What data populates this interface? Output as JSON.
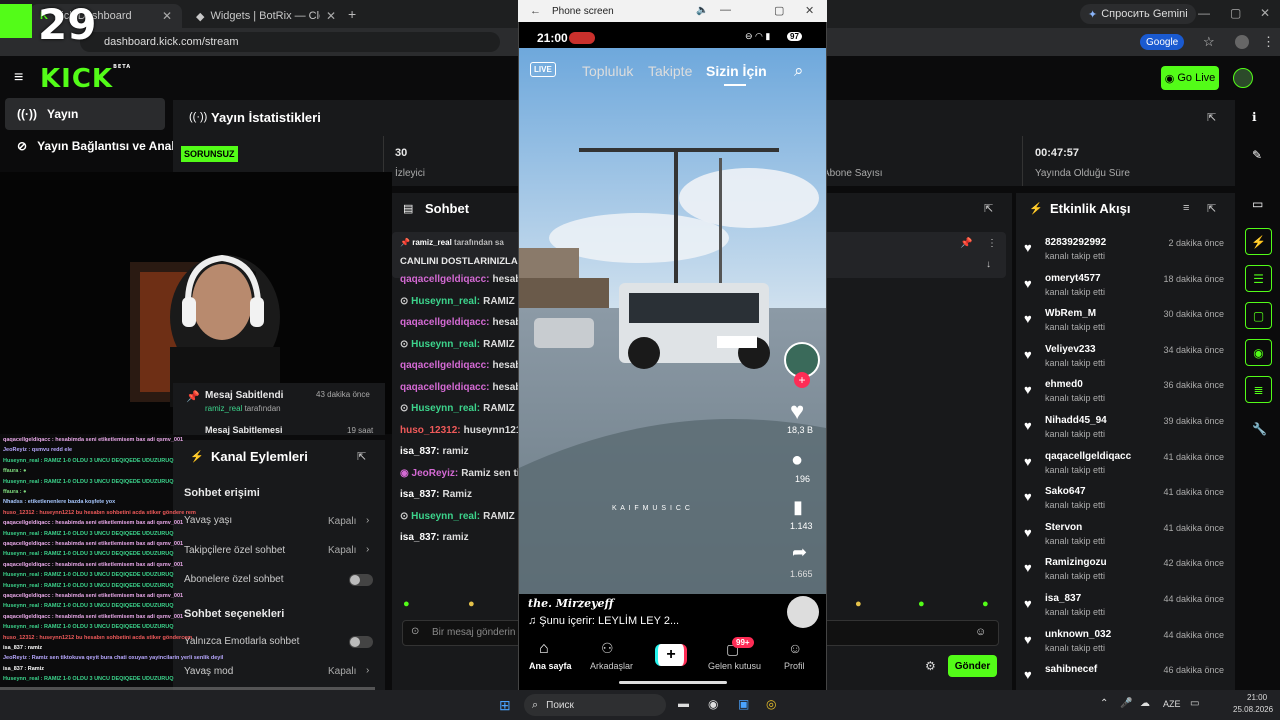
{
  "browser": {
    "tabs": [
      {
        "label": "Kick Dashboard"
      },
      {
        "label": "Widgets | BotRix — Cloud Strea"
      }
    ],
    "new_tab": "+",
    "url": "dashboard.kick.com/stream",
    "gemini": "Спросить Gemini",
    "google": "Google"
  },
  "overlay_counter": "29",
  "kick": {
    "logo": "KICK",
    "beta": "BETA",
    "go_live": "Go Live",
    "nav": [
      {
        "label": "Yayın"
      },
      {
        "label": "Yayın Bağlantısı ve Anahta"
      }
    ]
  },
  "stats": {
    "title": "Yayın İstatistikleri",
    "status_badge": "SORUNSUZ",
    "viewers_value": "30",
    "viewers_label": "İzleyici",
    "subs_label": "Abone Sayısı",
    "duration_value": "00:47:57",
    "duration_label": "Yayında Olduğu Süre"
  },
  "pinned": {
    "title": "Mesaj Sabitlendi",
    "by": "ramiz_real",
    "by_suffix": "tarafından",
    "time": "43 dakika önce",
    "title2": "Mesaj Sabitlemesi",
    "time2": "19 saat"
  },
  "channel_actions": {
    "title": "Kanal Eylemleri",
    "sec1": "Sohbet erişimi",
    "items1": [
      {
        "label": "Yavaş yaşı",
        "value": "Kapalı"
      },
      {
        "label": "Takipçilere özel sohbet",
        "value": "Kapalı"
      },
      {
        "label": "Abonelere özel sohbet"
      }
    ],
    "sec2": "Sohbet seçenekleri",
    "items2": [
      {
        "label": "Yalnızca Emotlarla sohbet"
      },
      {
        "label": "Yavaş mod",
        "value": "Kapalı"
      }
    ]
  },
  "chat": {
    "title": "Sohbet",
    "pinned_user": "ramiz_real",
    "pinned_suffix": "tarafından sa",
    "pinned_msg": "CANLINI DOSTLARINIZLA",
    "lines": [
      {
        "user": "qaqacellgeldiqacc:",
        "msg": "hesabi",
        "color": "purple"
      },
      {
        "user": "Huseynn_real:",
        "msg": "RAMIZ 1",
        "color": "green"
      },
      {
        "user": "qaqacellgeldiqacc:",
        "msg": "hesabi",
        "color": "purple"
      },
      {
        "user": "Huseynn_real:",
        "msg": "RAMIZ 1",
        "color": "green"
      },
      {
        "user": "qaqacellgeldiqacc:",
        "msg": "hesabi",
        "color": "purple"
      },
      {
        "user": "qaqacellgeldiqacc:",
        "msg": "hesabi",
        "color": "purple"
      },
      {
        "user": "Huseynn_real:",
        "msg": "RAMIZ 1",
        "color": "green"
      },
      {
        "user": "huso_12312:",
        "msg": "huseynn1212 h",
        "color": "red"
      },
      {
        "user": "isa_837:",
        "msg": "ramiz",
        "color": "white"
      },
      {
        "user": "JeoReyiz:",
        "msg": "Ramiz sen tik",
        "color": "purple"
      },
      {
        "user": "isa_837:",
        "msg": "Ramiz",
        "color": "white"
      },
      {
        "user": "Huseynn_real:",
        "msg": "RAMIZ 1",
        "color": "green"
      },
      {
        "user": "isa_837:",
        "msg": "ramiz",
        "color": "white"
      }
    ],
    "input_placeholder": "Bir mesaj gönderin",
    "send": "Gönder"
  },
  "activity": {
    "title": "Etkinlik Akışı",
    "items": [
      {
        "name": "82839292992",
        "sub": "kanalı takip etti",
        "time": "2 dakika önce"
      },
      {
        "name": "omeryt4577",
        "sub": "kanalı takip etti",
        "time": "18 dakika önce"
      },
      {
        "name": "WbRem_M",
        "sub": "kanalı takip etti",
        "time": "30 dakika önce"
      },
      {
        "name": "Veliyev233",
        "sub": "kanalı takip etti",
        "time": "34 dakika önce"
      },
      {
        "name": "ehmed0",
        "sub": "kanalı takip etti",
        "time": "36 dakika önce"
      },
      {
        "name": "Nihadd45_94",
        "sub": "kanalı takip etti",
        "time": "39 dakika önce"
      },
      {
        "name": "qaqacellgeldiqacc",
        "sub": "kanalı takip etti",
        "time": "41 dakika önce"
      },
      {
        "name": "Sako647",
        "sub": "kanalı takip etti",
        "time": "41 dakika önce"
      },
      {
        "name": "Stervon",
        "sub": "kanalı takip etti",
        "time": "41 dakika önce"
      },
      {
        "name": "Ramizingozu",
        "sub": "kanalı takip etti",
        "time": "42 dakika önce"
      },
      {
        "name": "isa_837",
        "sub": "kanalı takip etti",
        "time": "44 dakika önce"
      },
      {
        "name": "unknown_032",
        "sub": "kanalı takip etti",
        "time": "44 dakika önce"
      },
      {
        "name": "sahibnecef",
        "sub": "",
        "time": "46 dakika önce"
      }
    ]
  },
  "phone": {
    "window_title": "Phone screen",
    "time": "21:00",
    "battery": "97",
    "live": "LIVE",
    "tabs": [
      "Topluluk",
      "Takipte",
      "Sizin İçin"
    ],
    "likes": "18,3 B",
    "comments": "196",
    "saves": "1.143",
    "shares": "1.665",
    "author": "the. Mirzeyeff",
    "music": "♫ Şunu içerir: LEYLİM LEY 2...",
    "watermark": "K A I F M U S I C C",
    "nav": [
      {
        "label": "Ana sayfa"
      },
      {
        "label": "Arkadaşlar"
      },
      {
        "label": "+"
      },
      {
        "label": "Gelen kutusu",
        "badge": "99+"
      },
      {
        "label": "Profil"
      }
    ]
  },
  "overlay_chat": [
    {
      "text": "qaqacellgeldiqacc : hesabimda seni etiketlemisem bax adi qsmv_001",
      "color": "#e8a8e8"
    },
    {
      "text": "JeoReyiz : qsmvu redd ele",
      "color": "#b8a8ff"
    },
    {
      "text": "Huseynn_real : RAMIZ 1-0 OLDU 3 UNCU DEQIQEDE UDUZURUQ",
      "color": "#3cd48c"
    },
    {
      "text": "ffaura : ●",
      "color": "#7fdc7f"
    },
    {
      "text": "Huseynn_real : RAMIZ 1-0 OLDU 3 UNCU DEQIQEDE UDUZURUQ",
      "color": "#3cd48c"
    },
    {
      "text": "ffaura : ●",
      "color": "#7fdc7f"
    },
    {
      "text": "Nhadss : etiketlenenlere bazda koşfete yox",
      "color": "#a8c8ff"
    },
    {
      "text": "huso_12312 : huseynn1212 bu hesabın sohbetini acda stiker göndere rem",
      "color": "#f05a5a"
    },
    {
      "text": "qaqacellgeldiqacc : hesabimda seni etiketlemisem bax adi qsmv_001",
      "color": "#e8a8e8"
    },
    {
      "text": "Huseynn_real : RAMIZ 1-0 OLDU 3 UNCU DEQIQEDE UDUZURUQ",
      "color": "#3cd48c"
    },
    {
      "text": "qaqacellgeldiqacc : hesabimda seni etiketlemisem bax adi qsmv_001",
      "color": "#e8a8e8"
    },
    {
      "text": "Huseynn_real : RAMIZ 1-0 OLDU 3 UNCU DEQIQEDE UDUZURUQ",
      "color": "#3cd48c"
    },
    {
      "text": "qaqacellgeldiqacc : hesabimda seni etiketlemisem bax adi qsmv_001",
      "color": "#e8a8e8"
    },
    {
      "text": "Huseynn_real : RAMIZ 1-0 OLDU 3 UNCU DEQIQEDE UDUZURUQ",
      "color": "#3cd48c"
    },
    {
      "text": "Huseynn_real : RAMIZ 1-0 OLDU 3 UNCU DEQIQEDE UDUZURUQ",
      "color": "#3cd48c"
    },
    {
      "text": "qaqacellgeldiqacc : hesabimda seni etiketlemisem bax adi qsmv_001",
      "color": "#e8a8e8"
    },
    {
      "text": "Huseynn_real : RAMIZ 1-0 OLDU 3 UNCU DEQIQEDE UDUZURUQ",
      "color": "#3cd48c"
    },
    {
      "text": "qaqacellgeldiqacc : hesabimda seni etiketlemisem bax adi qsmv_001",
      "color": "#e8a8e8"
    },
    {
      "text": "Huseynn_real : RAMIZ 1-0 OLDU 3 UNCU DEQIQEDE UDUZURUQ",
      "color": "#3cd48c"
    },
    {
      "text": "huso_12312 : huseynn1212 bu hesabın sohbetini acda stiker göndercem",
      "color": "#f05a5a"
    },
    {
      "text": "isa_837 : ramiz",
      "color": "#ffffff"
    },
    {
      "text": "JeoReyiz : Ramiz sen tiktokuva qeyit bura chati oxuyan yayincilarin yerli senlik deyil",
      "color": "#b8a8ff"
    },
    {
      "text": "isa_837 : Ramiz",
      "color": "#ffffff"
    },
    {
      "text": "Huseynn_real : RAMIZ 1-0 OLDU 3 UNCU DEQIQEDE UDUZURUQ",
      "color": "#3cd48c"
    }
  ],
  "taskbar": {
    "search": "Поиск",
    "lang": "AZE",
    "time": "21:00",
    "date": "25.08.2026"
  }
}
